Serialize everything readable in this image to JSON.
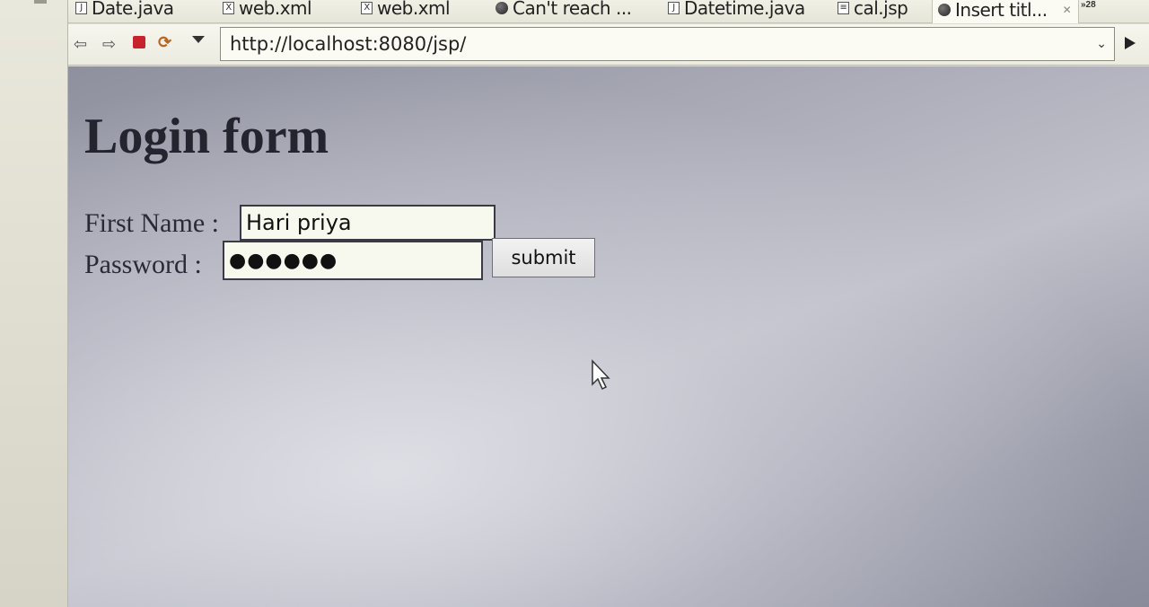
{
  "tabs": [
    {
      "label": "Date.java",
      "icon": "java-file-icon"
    },
    {
      "label": "web.xml",
      "icon": "xml-file-icon"
    },
    {
      "label": "web.xml",
      "icon": "xml-file-icon"
    },
    {
      "label": "Can't reach ...",
      "icon": "globe-icon"
    },
    {
      "label": "Datetime.java",
      "icon": "java-file-icon"
    },
    {
      "label": "cal.jsp",
      "icon": "jsp-file-icon"
    },
    {
      "label": "Insert titl...",
      "icon": "globe-icon",
      "active": true
    }
  ],
  "tab_overflow": "»28",
  "toolbar": {
    "url": "http://localhost:8080/jsp/"
  },
  "page": {
    "title": "Login form",
    "first_name_label": "First Name :",
    "first_name_value": "Hari priya",
    "password_label": "Password :",
    "password_value": "●●●●●●",
    "submit_label": "submit"
  },
  "colors": {
    "stop_button": "#c8232c",
    "page_title": "#24242e"
  }
}
